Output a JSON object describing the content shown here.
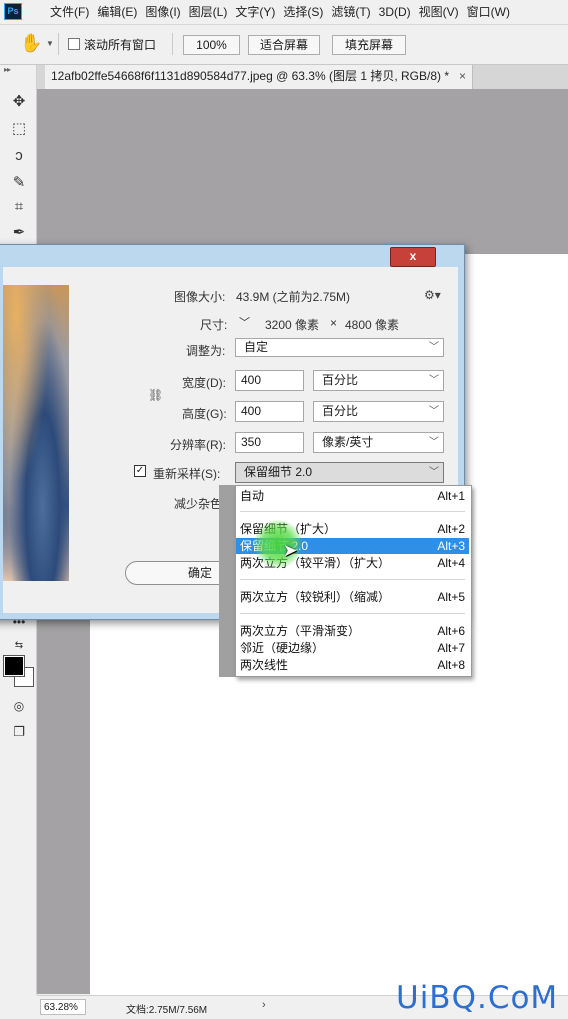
{
  "app": {
    "logo": "Ps"
  },
  "menu": [
    "文件(F)",
    "编辑(E)",
    "图像(I)",
    "图层(L)",
    "文字(Y)",
    "选择(S)",
    "滤镜(T)",
    "3D(D)",
    "视图(V)",
    "窗口(W)"
  ],
  "options": {
    "scroll_all_windows": "滚动所有窗口",
    "zoom_value": "100%",
    "fit_screen": "适合屏幕",
    "fill_screen": "填充屏幕"
  },
  "document": {
    "tab_title": "12afb02ffe54668f6f1131d890584d77.jpeg @ 63.3% (图层 1 拷贝, RGB/8) *",
    "tab_close": "×"
  },
  "statusbar": {
    "zoom": "63.28%",
    "doc_size": "文档:2.75M/7.56M",
    "arrow": "›"
  },
  "watermark": "UiBQ.CoM",
  "dialog": {
    "image_size_label": "图像大小:",
    "image_size_value": "43.9M (之前为2.75M)",
    "dimensions_label": "尺寸:",
    "dimensions_w": "3200 像素",
    "dimensions_x": "×",
    "dimensions_h": "4800 像素",
    "fit_to_label": "调整为:",
    "fit_to_value": "自定",
    "width_label": "宽度(D):",
    "width_value": "400",
    "width_unit": "百分比",
    "height_label": "高度(G):",
    "height_value": "400",
    "height_unit": "百分比",
    "resolution_label": "分辨率(R):",
    "resolution_value": "350",
    "resolution_unit": "像素/英寸",
    "resample_label": "重新采样(S):",
    "resample_value": "保留细节 2.0",
    "noise_label": "减少杂色:",
    "ok_label": "确定",
    "close_label": "x"
  },
  "resample_menu": [
    {
      "name": "自动",
      "shortcut": "Alt+1"
    },
    {
      "name": "保留细节（扩大）",
      "shortcut": "Alt+2"
    },
    {
      "name": "保留细节 2.0",
      "shortcut": "Alt+3",
      "selected": true
    },
    {
      "name": "两次立方（较平滑）（扩大）",
      "shortcut": "Alt+4"
    },
    {
      "name": "两次立方（较锐利）（缩减）",
      "shortcut": "Alt+5"
    },
    {
      "name": "两次立方（平滑渐变）",
      "shortcut": "Alt+6"
    },
    {
      "name": "邻近（硬边缘）",
      "shortcut": "Alt+7"
    },
    {
      "name": "两次线性",
      "shortcut": "Alt+8"
    }
  ],
  "colors": {
    "selection": "#2f8fe6",
    "dialog_frame": "#bcd8ef",
    "close": "#c5413a",
    "canvas_bg": "#a4a2a4"
  }
}
